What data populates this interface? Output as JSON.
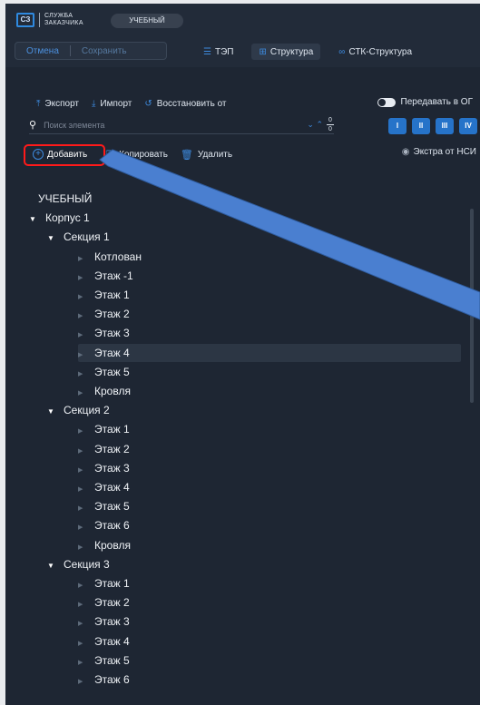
{
  "header": {
    "logo_mark": "СЗ",
    "logo_line1": "СЛУЖБА",
    "logo_line2": "ЗАКАЗЧИКА",
    "mode_label": "УЧЕБНЫЙ",
    "cancel_label": "Отмена",
    "save_label": "Сохранить",
    "tabs": [
      {
        "label": "ТЭП",
        "icon": "list-icon",
        "active": false
      },
      {
        "label": "Структура",
        "icon": "structure-icon",
        "active": true
      },
      {
        "label": "СТК-Структура",
        "icon": "link-icon",
        "active": false
      }
    ]
  },
  "toolbar": {
    "export_label": "Экспорт",
    "import_label": "Импорт",
    "restore_label": "Восстановить от",
    "transfer_label": "Передавать в ОГ",
    "transfer_on": true
  },
  "search": {
    "placeholder": "Поиск элемента",
    "count_top": "0",
    "count_bottom": "0"
  },
  "levels": [
    "I",
    "II",
    "III",
    "IV"
  ],
  "actions": {
    "add_label": "Добавить",
    "copy_label": "Копировать",
    "delete_label": "Удалить",
    "extra_label": "Экстра от НСИ"
  },
  "tree": {
    "root": "УЧЕБНЫЙ",
    "building": "Корпус 1",
    "sections": [
      {
        "label": "Секция 1",
        "floors": [
          "Котлован",
          "Этаж -1",
          "Этаж 1",
          "Этаж 2",
          "Этаж 3",
          "Этаж 4",
          "Этаж 5",
          "Кровля"
        ],
        "selected": "Этаж 4"
      },
      {
        "label": "Секция 2",
        "floors": [
          "Этаж 1",
          "Этаж 2",
          "Этаж 3",
          "Этаж 4",
          "Этаж 5",
          "Этаж 6",
          "Кровля"
        ]
      },
      {
        "label": "Секция 3",
        "floors": [
          "Этаж 1",
          "Этаж 2",
          "Этаж 3",
          "Этаж 4",
          "Этаж 5",
          "Этаж 6"
        ]
      }
    ]
  },
  "colors": {
    "accent": "#3d8be0",
    "background": "#1e2633",
    "annotation_box": "#ff1a1a",
    "annotation_arrow": "#4a7fd0"
  }
}
